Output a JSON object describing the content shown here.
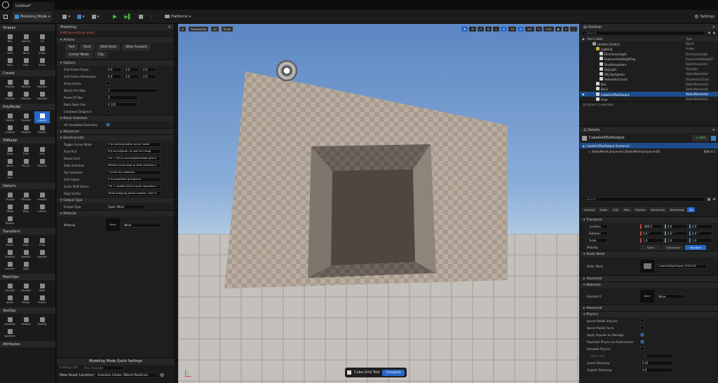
{
  "titlebar": {
    "tab": "Untitled*"
  },
  "toolbar": {
    "mode": "Modeling Mode",
    "platforms": "Platforms",
    "settings": "Settings"
  },
  "tools": {
    "categories": [
      {
        "name": "Shapes",
        "items": [
          "Box",
          "Sphere",
          "Cyl",
          "Cone",
          "Torus",
          "Arrow",
          "Rect",
          "Disc",
          "Stairs"
        ]
      },
      {
        "name": "Create",
        "items": [
          "PolyExt",
          "PathExt",
          "PathRev",
          "PolyRev",
          "MshBoo",
          "MshSplit"
        ]
      },
      {
        "name": "PolyModel",
        "items": [
          "PolyEd",
          "PolyDef",
          "CubeGr",
          "UnWeld",
          "MeshEd",
          "SubDiv"
        ]
      },
      {
        "name": "TriModel",
        "items": [
          "TriSel",
          "TriEd",
          "HFill",
          "Mirror",
          "PlnCut",
          "PolyCut",
          "Trim"
        ]
      },
      {
        "name": "Deform",
        "items": [
          "VSculpt",
          "DSculpt",
          "Smooth",
          "Offset",
          "Warp",
          "Lattice",
          "Displce"
        ]
      },
      {
        "name": "Transform",
        "items": [
          "XForm",
          "Align",
          "Pivot",
          "PivotAct",
          "BakeRS",
          "Transfer",
          "Convert",
          "Split"
        ]
      },
      {
        "name": "MeshOps",
        "items": [
          "Simplify",
          "Remesh",
          "Weld",
          "Jacket",
          "Merge",
          "Project"
        ]
      },
      {
        "name": "VoxOps",
        "items": [
          "VoxWrap",
          "VoxBool",
          "VoxMrg",
          "VoxMesh"
        ]
      },
      {
        "name": "Attributes",
        "items": []
      }
    ]
  },
  "modeling": {
    "tab": "Modeling",
    "warning": "Editing existing asset.",
    "sections": {
      "actions": "Actions",
      "options": "Options",
      "block": "Block Selection",
      "advanced": "Advanced",
      "shortcut": "Shortcut Info",
      "output": "Output Type",
      "material": "Material"
    },
    "actions": [
      "Pull",
      "Push",
      "Slide Back",
      "Slide Forward",
      "Corner Mode",
      "Flip"
    ],
    "options": [
      {
        "label": "Grid Frame Origin",
        "v": [
          "0.0",
          "0.0",
          "0.0"
        ]
      },
      {
        "label": "Grid Frame Orientation",
        "v": [
          "0.0",
          "0.0",
          "0.0"
        ]
      },
      {
        "label": "Show Gizmo",
        "v": []
      },
      {
        "label": "Blocks Per Step",
        "v": [
          "1"
        ]
      },
      {
        "label": "Power Of Two",
        "v": [
          "0"
        ]
      },
      {
        "label": "Block Base Size",
        "v": [
          "0.125"
        ]
      },
      {
        "label": "Crosswise Diagonal",
        "v": []
      }
    ],
    "hitlabel": "Hit Unrelated Geometry",
    "shortcuts": [
      {
        "label": "Toggle Corner Mode",
        "v": "Z to start/complete corner mode."
      },
      {
        "label": "Push Pull",
        "v": "E/Q to pull/push, or use Ctrl+drag"
      },
      {
        "label": "Resize Grid",
        "v": "Ctrl + E/Q to increase/decrease grid si"
      },
      {
        "label": "Slide Selection",
        "v": "Middle mouse drag to slide selection o"
      },
      {
        "label": "Flip Selection",
        "v": "T to flip the selection."
      },
      {
        "label": "Grid Gizmo",
        "v": "R to show/hide grid gizmo."
      },
      {
        "label": "Quick Shift Gizmo",
        "v": "Ctrl + middle click to quick reposition t"
      },
      {
        "label": "Align Gizmo",
        "v": "While dragging gizmo handles, hold Ct"
      }
    ],
    "output": {
      "label": "Output Type",
      "value": "Static Mesh"
    },
    "material": {
      "label": "Material",
      "thumb": "None",
      "value": "None"
    },
    "quick": {
      "title": "Modeling Mode Quick Settings",
      "lod_label": "Editing LOD",
      "lod_value": "Max Available",
      "loc_label": "New Asset Location",
      "loc_value": "AutoGen Folder (World-Relative)"
    }
  },
  "viewport": {
    "perspective": "Perspective",
    "lit": "Lit",
    "show": "Show",
    "grid": "10",
    "angle": "10°",
    "scale": "0.25",
    "cam": "4",
    "cube_tool": "Cube Grid Tool",
    "complete": "Complete"
  },
  "outliner": {
    "tab": "Outliner",
    "search": "Search...",
    "col_label": "Item Label",
    "col_type": "Type",
    "rows": [
      {
        "name": "Untitled (Editor)",
        "type": "World",
        "ind": 2,
        "c": "#9b9b9b"
      },
      {
        "name": "Lighting",
        "type": "Folder",
        "ind": 3,
        "c": "#c9a84a"
      },
      {
        "name": "DirectionalLight",
        "type": "DirectionalLight",
        "ind": 4,
        "c": "#d6d6d6"
      },
      {
        "name": "ExponentialHeightFog",
        "type": "ExponentialHeightF",
        "ind": 4,
        "c": "#d6d6d6"
      },
      {
        "name": "SkyAtmosphere",
        "type": "SkyAtmosphere",
        "ind": 4,
        "c": "#d6d6d6"
      },
      {
        "name": "SkyLight",
        "type": "SkyLight",
        "ind": 4,
        "c": "#d6d6d6"
      },
      {
        "name": "SM_SkySphere",
        "type": "StaticMeshActor",
        "ind": 4,
        "c": "#d6d6d6"
      },
      {
        "name": "VolumetricCloud",
        "type": "VolumetricCloud",
        "ind": 4,
        "c": "#d6d6d6"
      },
      {
        "name": "Box",
        "type": "StaticMeshActor",
        "ind": 3,
        "c": "#d6d6d6"
      },
      {
        "name": "Box2",
        "type": "StaticMeshActor",
        "ind": 3,
        "c": "#d6d6d6"
      },
      {
        "name": "CubeGridToolOutput",
        "type": "StaticMeshActor",
        "ind": 3,
        "c": "#d6d6d6",
        "sel": true
      },
      {
        "name": "Floor",
        "type": "StaticMeshActor",
        "ind": 3,
        "c": "#d6d6d6"
      }
    ],
    "footer": "10 actors (1 selected)"
  },
  "details": {
    "tab": "Details",
    "actor": "CubeGridToolOutput",
    "add": "+ Add",
    "instance": "CubeGridToolOutput (Instance)",
    "component": "StaticMeshComponent (StaticMeshComponent0)",
    "edit": "Edit in C",
    "search": "Search",
    "filters": [
      "General",
      "Actor",
      "LOD",
      "Misc",
      "Physics",
      "Rendering",
      "Streaming",
      "All"
    ],
    "transform": {
      "title": "Transform",
      "rows": [
        {
          "label": "Location",
          "v": [
            "-400.0",
            "0.0",
            "0.0"
          ]
        },
        {
          "label": "Rotation",
          "v": [
            "0.0 °",
            "0.0 °",
            "0.0 °"
          ]
        },
        {
          "label": "Scale",
          "v": [
            "1.0",
            "1.0",
            "1.0"
          ]
        }
      ],
      "mobility": "Mobility",
      "mob_opts": [
        "Static",
        "Stationary",
        "Movable"
      ]
    },
    "staticmesh": {
      "title": "Static Mesh",
      "label": "Static Mesh",
      "value": "CubeGridToolOutput_37612C8"
    },
    "advanced": "Advanced",
    "materials": {
      "title": "Materials",
      "label": "Element 0",
      "thumb": "None",
      "value": "None"
    },
    "physics": {
      "title": "Physics",
      "rows": [
        {
          "label": "Ignore Radial Impulse",
          "on": false
        },
        {
          "label": "Ignore Radial Force",
          "on": false
        },
        {
          "label": "Apply Impulse on Damage",
          "on": true
        },
        {
          "label": "Replicate Physics to Autonomous",
          "on": true
        },
        {
          "label": "Simulate Physics",
          "on": false
        }
      ],
      "mass_label": "Mass (kg)",
      "mass": "0.0",
      "linear_label": "Linear Damping",
      "linear": "0.01",
      "angular_label": "Angular Damping",
      "angular": "0.0"
    }
  }
}
